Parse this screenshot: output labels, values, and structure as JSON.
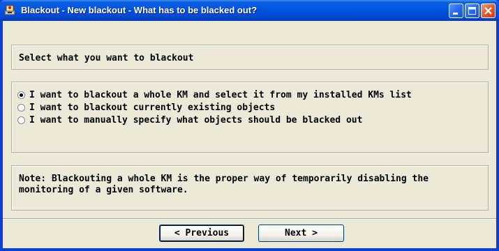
{
  "window": {
    "title": "Blackout - New blackout - What has to be blacked out?",
    "app_icon": "blackout-app-icon",
    "controls": [
      "minimize-icon",
      "maximize-icon",
      "close-icon"
    ]
  },
  "header": {
    "prompt": "Select what you want to blackout"
  },
  "options": [
    {
      "label": "I want to blackout a whole KM and select it from my installed KMs list",
      "selected": true
    },
    {
      "label": "I want to blackout currently existing objects",
      "selected": false
    },
    {
      "label": "I want to manually specify what objects should be blacked out",
      "selected": false
    }
  ],
  "note": {
    "text": "Note: Blackouting a whole KM is the proper way of temporarily disabling the monitoring of a given software."
  },
  "buttons": {
    "previous": "< Previous",
    "next": "Next >"
  },
  "colors": {
    "titlebar": "#0054e3",
    "client_bg": "#ece9d8",
    "close_button": "#e25a2f"
  }
}
